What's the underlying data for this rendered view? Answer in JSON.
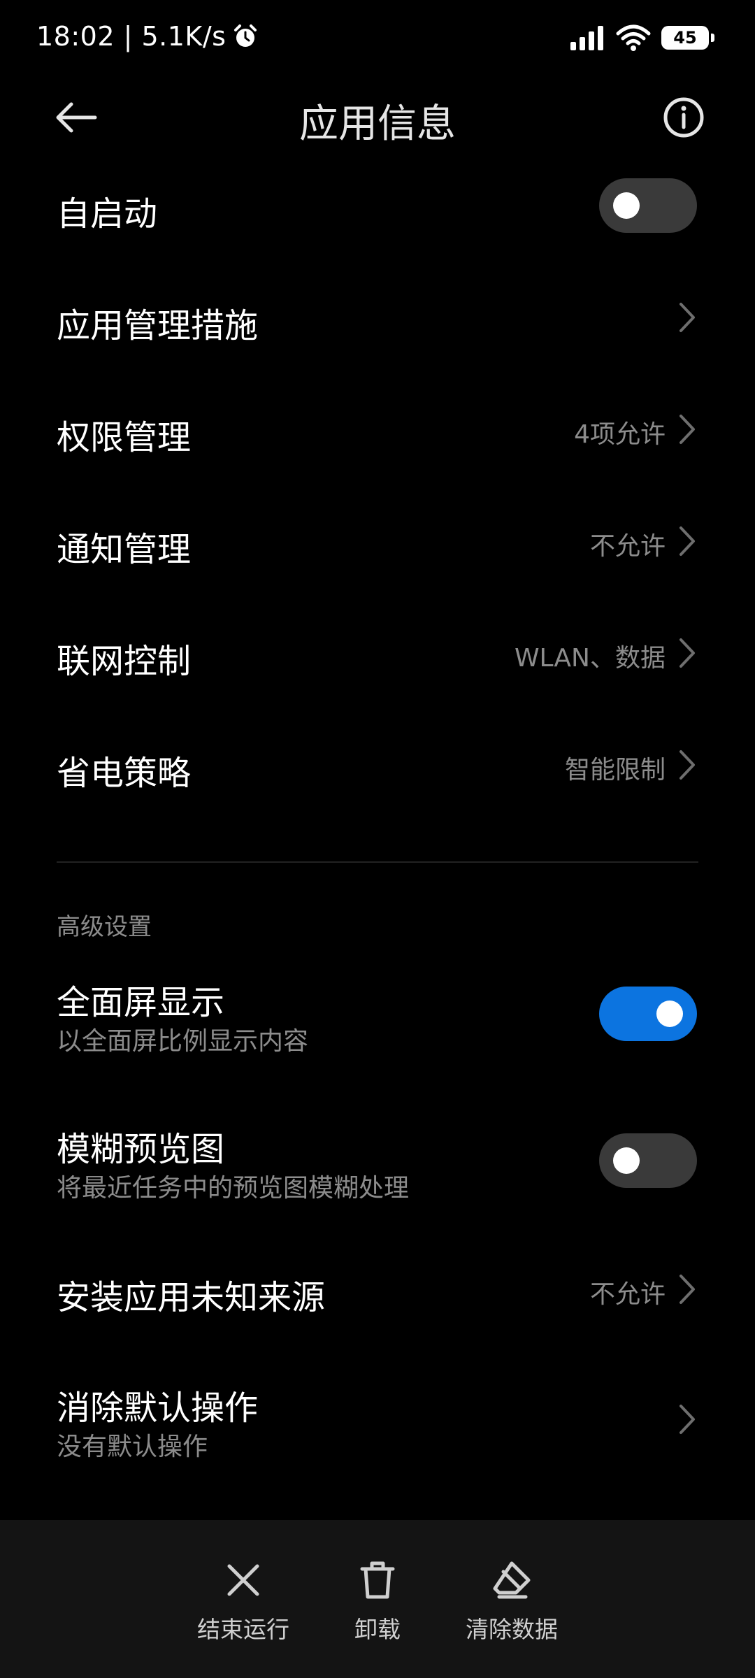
{
  "status": {
    "time_speed": "18:02 | 5.1K/s",
    "battery": "45"
  },
  "header": {
    "title": "应用信息"
  },
  "rows": {
    "autostart": {
      "title": "自启动",
      "enabled": false
    },
    "app_management": {
      "title": "应用管理措施"
    },
    "permissions": {
      "title": "权限管理",
      "value": "4项允许"
    },
    "notifications": {
      "title": "通知管理",
      "value": "不允许"
    },
    "network": {
      "title": "联网控制",
      "value": "WLAN、数据"
    },
    "battery_saver": {
      "title": "省电策略",
      "value": "智能限制"
    }
  },
  "advanced": {
    "section_label": "高级设置",
    "fullscreen": {
      "title": "全面屏显示",
      "subtitle": "以全面屏比例显示内容",
      "enabled": true
    },
    "blur_preview": {
      "title": "模糊预览图",
      "subtitle": "将最近任务中的预览图模糊处理",
      "enabled": false
    },
    "unknown_sources": {
      "title": "安装应用未知来源",
      "value": "不允许"
    },
    "clear_defaults": {
      "title": "消除默认操作",
      "subtitle": "没有默认操作"
    }
  },
  "bottom": {
    "force_stop": "结束运行",
    "uninstall": "卸载",
    "clear_data": "清除数据"
  },
  "colors": {
    "background": "#000000",
    "toggle_on": "#0c74e0",
    "toggle_off": "#3a3a3a",
    "secondary_text": "#8c8c8c",
    "bottom_bar": "#141414"
  }
}
